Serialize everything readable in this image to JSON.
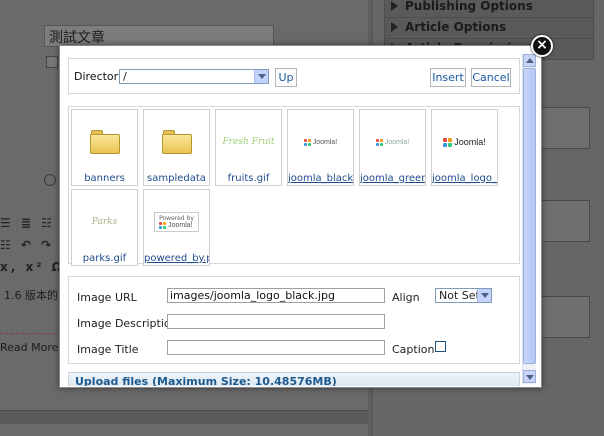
{
  "background": {
    "title_value": "測試文章",
    "panels": [
      "Publishing Options",
      "Article Options",
      "Article Permissions"
    ],
    "body_text": "1.6 版本的",
    "readmore": "Read More",
    "toolbar_rows": [
      "☰ ≣ ☷",
      "☷ ↶ ↷",
      "x, x² Ω"
    ]
  },
  "modal": {
    "directory_label": "Directory",
    "directory_value": "/",
    "up_label": "Up",
    "insert_label": "Insert",
    "cancel_label": "Cancel",
    "files": [
      {
        "name": "banners",
        "kind": "folder"
      },
      {
        "name": "sampledata",
        "kind": "folder"
      },
      {
        "name": "fruits.gif",
        "kind": "image",
        "logo_text": "Fresh Fruit"
      },
      {
        "name": "joomla_black.g",
        "kind": "image",
        "logo_text": "Joomla!"
      },
      {
        "name": "joomla_green.g",
        "kind": "image",
        "logo_text": "Joomla!"
      },
      {
        "name": "joomla_logo_bl",
        "kind": "image",
        "logo_text": "Joomla!"
      },
      {
        "name": "parks.gif",
        "kind": "image",
        "logo_text": "Parks"
      },
      {
        "name": "powered_by.p",
        "kind": "image",
        "logo_text": "Joomla!",
        "logo_top": "Powered by"
      }
    ],
    "image_url_label": "Image URL",
    "image_url_value": "images/joomla_logo_black.jpg",
    "align_label": "Align",
    "align_value": "Not Set",
    "image_description_label": "Image Description",
    "image_description_value": "",
    "image_title_label": "Image Title",
    "image_title_value": "",
    "caption_label": "Caption",
    "upload_label": "Upload files (Maximum Size: 10.48576MB)",
    "close_symbol": "×"
  },
  "colors": {
    "link": "#1f4b8e",
    "button_text": "#1a5aa6",
    "upload_text": "#1c5a8f"
  }
}
